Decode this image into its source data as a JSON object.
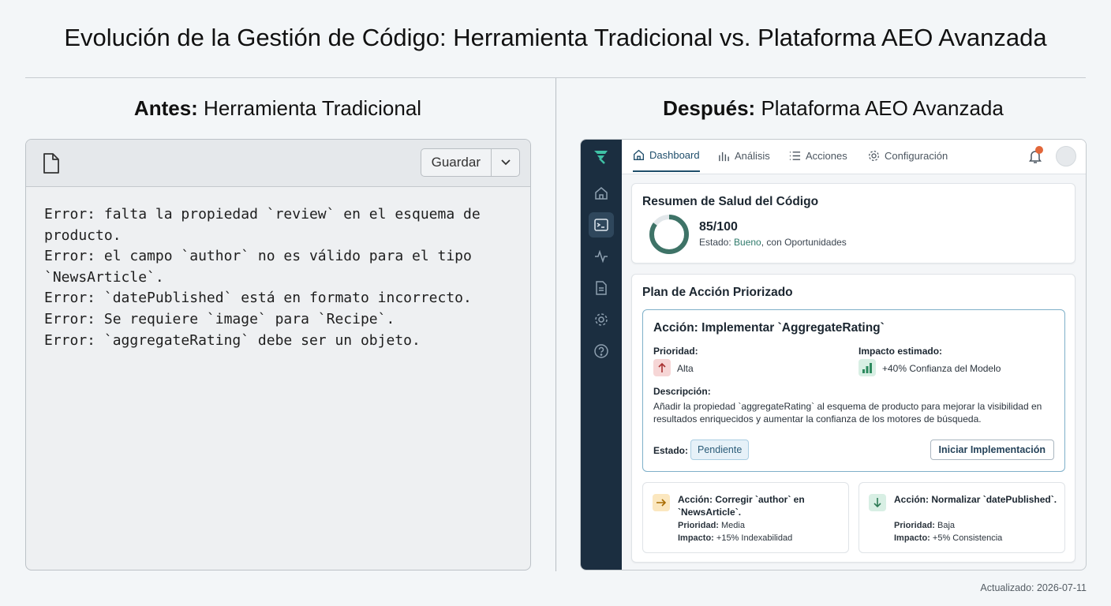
{
  "title": "Evolución de la Gestión de Código: Herramienta Tradicional vs. Plataforma AEO Avanzada",
  "left": {
    "heading_bold": "Antes:",
    "heading_rest": " Herramienta Tradicional",
    "save_label": "Guardar",
    "errors": [
      "Error: falta la propiedad `review` en el esquema de\nproducto.",
      "Error: el campo `author` no es válido para el tipo\n`NewsArticle`.",
      "Error: `datePublished` está en formato incorrecto.",
      "Error: Se requiere `image` para `Recipe`.",
      "Error: `aggregateRating` debe ser un objeto."
    ]
  },
  "right": {
    "heading_bold": "Después:",
    "heading_rest": " Plataforma AEO Avanzada",
    "nav": [
      "Dashboard",
      "Análisis",
      "Acciones",
      "Configuración"
    ],
    "health": {
      "title": "Resumen de Salud del Código",
      "score": "85/100",
      "score_value": 85,
      "status_prefix": "Estado: ",
      "status_good": "Bueno",
      "status_suffix": ", con Oportunidades"
    },
    "plan": {
      "title": "Plan de Acción Priorizado",
      "main_action": {
        "title": "Acción: Implementar `AggregateRating`",
        "priority_label": "Prioridad:",
        "priority_value": "Alta",
        "impact_label": "Impacto estimado:",
        "impact_value": "+40% Confianza del Modelo",
        "desc_label": "Descripción:",
        "desc": "Añadir la propiedad `aggregateRating` al esquema de producto para mejorar la visibilidad en resultados enriquecidos y aumentar la confianza de los motores de búsqueda.",
        "status_label": "Estado:",
        "status_value": "Pendiente",
        "button": "Iniciar Implementación"
      },
      "secondary": [
        {
          "title": "Acción: Corregir `author` en `NewsArticle`.",
          "priority_label": "Prioridad:",
          "priority_value": " Media",
          "impact_label": "Impacto:",
          "impact_value": " +15% Indexabilidad"
        },
        {
          "title": "Acción: Normalizar `datePublished`.",
          "priority_label": "Prioridad:",
          "priority_value": " Baja",
          "impact_label": "Impacto:",
          "impact_value": " +5% Consistencia"
        }
      ]
    }
  },
  "footer": "Actualizado: 2026-07-11",
  "colors": {
    "sidebar": "#1b2e40",
    "accent": "#1f4e6b",
    "good": "#2f7a6b",
    "alert": "#e2673a"
  }
}
